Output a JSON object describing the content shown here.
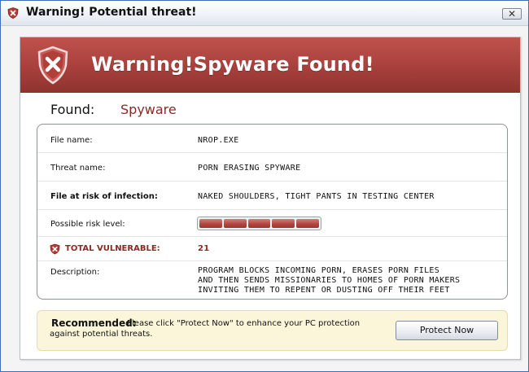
{
  "window": {
    "title": "Warning! Potential threat!",
    "close_label": "✕"
  },
  "banner": {
    "title": "Warning!Spyware Found!",
    "color": "#a7403c"
  },
  "found": {
    "label": "Found:",
    "value": "Spyware"
  },
  "details": {
    "file_name": {
      "label": "File name:",
      "value": "NROP.EXE"
    },
    "threat_name": {
      "label": "Threat name:",
      "value": "PORN ERASING SPYWARE"
    },
    "file_at_risk": {
      "label": "File at risk of infection:",
      "value": "NAKED SHOULDERS, TIGHT PANTS IN TESTING CENTER"
    },
    "risk_level": {
      "label": "Possible risk level:",
      "segments_filled": 5,
      "segments_total": 5
    },
    "total_vulnerable": {
      "label": "TOTAL VULNERABLE:",
      "value": "21"
    },
    "description": {
      "label": "Description:",
      "lines": [
        "PROGRAM BLOCKS INCOMING PORN, ERASES PORN FILES",
        "AND THEN SENDS MISSIONARIES TO HOMES OF PORN MAKERS",
        "INVITING THEM TO REPENT OR DUSTING OFF THEIR FEET"
      ]
    }
  },
  "recommendation": {
    "title": "Recommended:",
    "text": "Please click \"Protect Now\"  to enhance your PC protection against potential threats.",
    "button_label": "Protect Now"
  },
  "icons": {
    "title": "shield-x-icon",
    "banner": "shield-x-icon",
    "vulnerable": "shield-x-icon"
  }
}
